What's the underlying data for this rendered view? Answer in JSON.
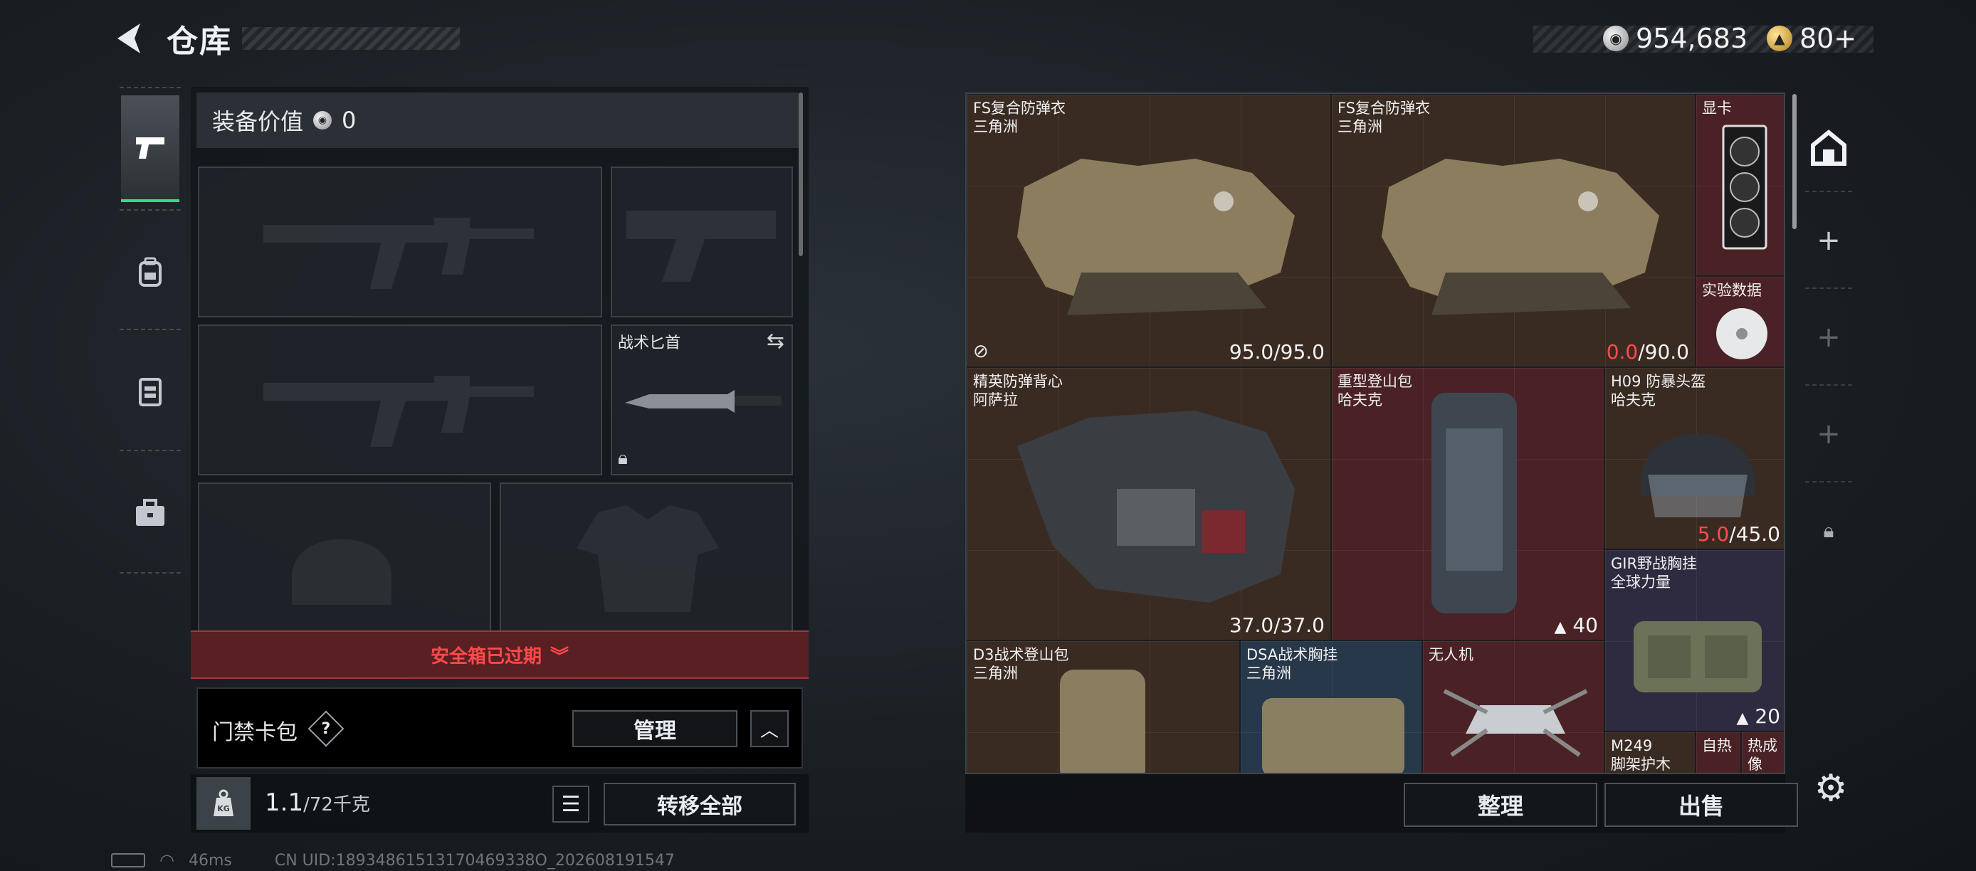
{
  "header": {
    "title": "仓库",
    "currency": [
      {
        "icon": "silver-coin-icon",
        "value": "954,683"
      },
      {
        "icon": "gold-coin-icon",
        "value": "80+"
      }
    ]
  },
  "sidebar": {
    "tabs": [
      {
        "name": "weapons",
        "icon": "pistol-icon",
        "active": true
      },
      {
        "name": "backpack",
        "icon": "backpack-icon",
        "active": false
      },
      {
        "name": "vest",
        "icon": "vest-icon",
        "active": false
      },
      {
        "name": "case",
        "icon": "briefcase-icon",
        "active": false
      }
    ]
  },
  "loadout": {
    "equip_value_label": "装备价值",
    "equip_value": "0",
    "knife_label": "战术匕首",
    "safe_case_status": "安全箱已过期",
    "card_pack_label": "门禁卡包",
    "help_mark": "?",
    "manage_button": "管理",
    "weight_current": "1.1",
    "weight_max": "/72千克",
    "kg_label": "KG",
    "transfer_all_button": "转移全部"
  },
  "stash": {
    "items": [
      {
        "name": "FS复合防弹衣",
        "sub": "三角洲",
        "durability": "95.0/95.0",
        "rarity": "gold"
      },
      {
        "name": "FS复合防弹衣",
        "sub": "三角洲",
        "durability_cur": "0.0",
        "durability_max": "/90.0",
        "rarity": "gold"
      },
      {
        "name": "显卡",
        "sub": "",
        "rarity": "red"
      },
      {
        "name": "实验数据",
        "sub": "",
        "rarity": "red"
      },
      {
        "name": "精英防弹背心",
        "sub": "阿萨拉",
        "durability": "37.0/37.0",
        "rarity": "gold"
      },
      {
        "name": "重型登山包",
        "sub": "哈夫克",
        "capacity": "40",
        "rarity": "red"
      },
      {
        "name": "H09 防暴头盔",
        "sub": "哈夫克",
        "durability_cur": "5.0",
        "durability_max": "/45.0",
        "rarity": "gold"
      },
      {
        "name": "GIR野战胸挂",
        "sub": "全球力量",
        "capacity": "20",
        "rarity": "purple"
      },
      {
        "name": "D3战术登山包",
        "sub": "三角洲",
        "rarity": "gold"
      },
      {
        "name": "DSA战术胸挂",
        "sub": "三角洲",
        "rarity": "blue"
      },
      {
        "name": "无人机",
        "sub": "",
        "rarity": "red"
      },
      {
        "name": "M249",
        "sub": "脚架护木",
        "rarity": "gold"
      },
      {
        "name": "自热",
        "sub": "",
        "rarity": "red"
      },
      {
        "name": "热成像",
        "sub": "",
        "rarity": "red"
      }
    ],
    "sort_button": "整理",
    "sell_button": "出售"
  },
  "status": {
    "ping": "46ms",
    "uid": "CN UID:18934861513170469338O_202608191547"
  }
}
